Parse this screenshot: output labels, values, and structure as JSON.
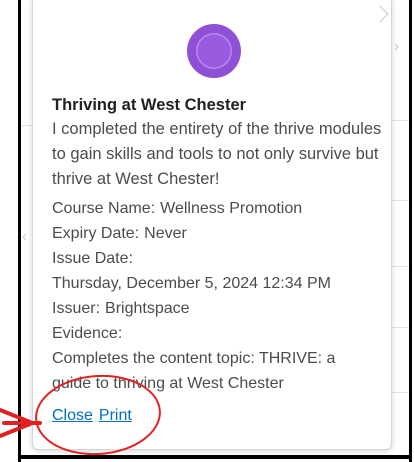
{
  "badge": {
    "icon": "thrive-badge-icon",
    "color": "#8f4fd6"
  },
  "award": {
    "title": "Thriving at West Chester",
    "description": "I completed the entirety of the thrive modules to gain skills and tools to not only survive but thrive at West Chester!"
  },
  "details": {
    "course_label": "Course Name:",
    "course_value": "Wellness Promotion",
    "expiry_label": "Expiry Date:",
    "expiry_value": "Never",
    "issue_label": "Issue Date:",
    "issue_value": "Thursday, December 5, 2024 12:34 PM",
    "issuer_label": "Issuer:",
    "issuer_value": "Brightspace",
    "evidence_label": "Evidence:",
    "evidence_line1": "Completes the content topic: THRIVE: a",
    "evidence_line2": "guide to thriving at West Chester"
  },
  "actions": {
    "close_label": "Close",
    "print_label": "Print"
  },
  "colors": {
    "link": "#006fbf",
    "annotation": "#e32020",
    "text": "#494c4e"
  }
}
